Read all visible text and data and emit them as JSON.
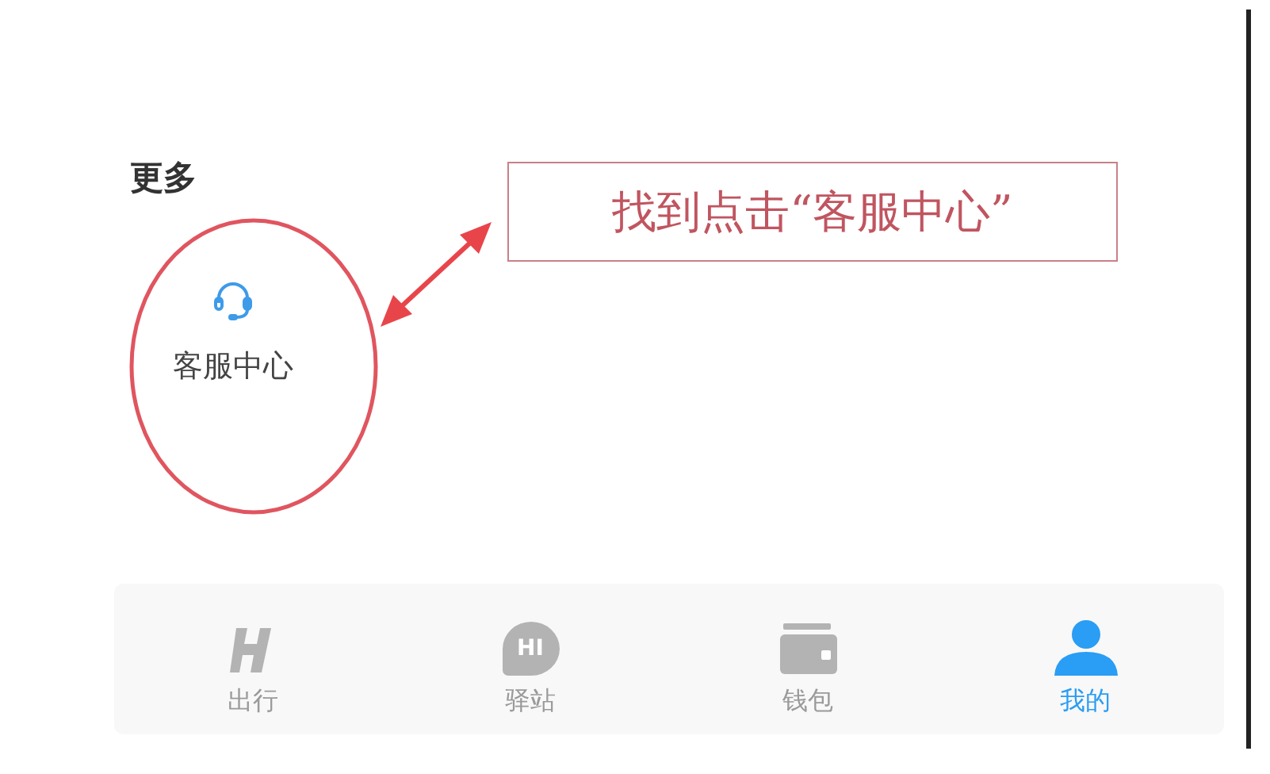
{
  "section": {
    "title": "更多"
  },
  "services": [
    {
      "label": "客服中心",
      "kind": "headset"
    }
  ],
  "annotation": {
    "text": "找到点击“客服中心”"
  },
  "tab_bar": [
    {
      "label": "出行",
      "kind": "logo",
      "selected": false
    },
    {
      "label": "驿站",
      "kind": "chat",
      "badge": "HI",
      "selected": false
    },
    {
      "label": "钱包",
      "kind": "wallet",
      "selected": false
    },
    {
      "label": "我的",
      "kind": "person",
      "selected": true
    }
  ]
}
